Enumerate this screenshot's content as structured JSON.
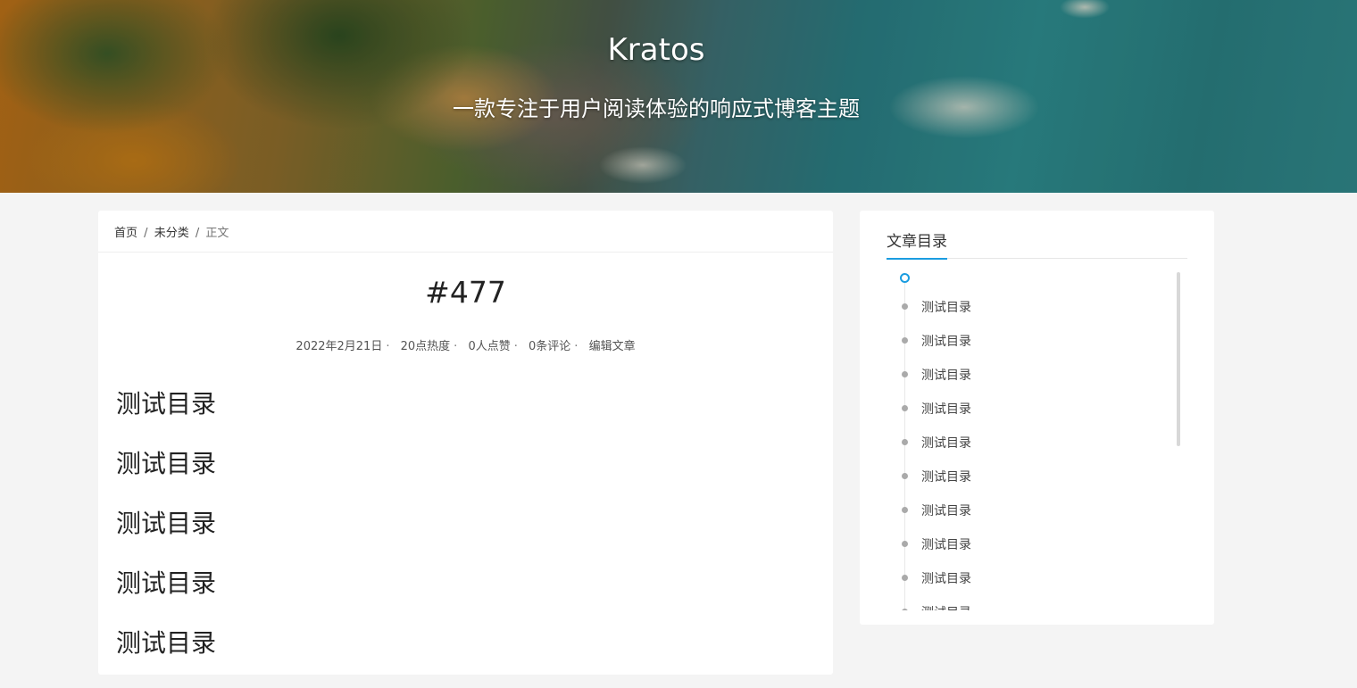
{
  "site": {
    "title": "Kratos",
    "subtitle": "一款专注于用户阅读体验的响应式博客主题"
  },
  "breadcrumb": {
    "home": "首页",
    "category": "未分类",
    "current": "正文",
    "separator": "/"
  },
  "post": {
    "title": "#477",
    "meta": {
      "date": "2022年2月21日",
      "views": "20点热度",
      "likes": "0人点赞",
      "comments": "0条评论",
      "edit": "编辑文章",
      "separator": "·"
    },
    "headings": [
      "测试目录",
      "测试目录",
      "测试目录",
      "测试目录",
      "测试目录"
    ]
  },
  "toc": {
    "title": "文章目录",
    "items": [
      "测试目录",
      "测试目录",
      "测试目录",
      "测试目录",
      "测试目录",
      "测试目录",
      "测试目录",
      "测试目录",
      "测试目录",
      "测试目录"
    ]
  },
  "colors": {
    "accent": "#1a9ce0",
    "background": "#f4f4f4"
  }
}
